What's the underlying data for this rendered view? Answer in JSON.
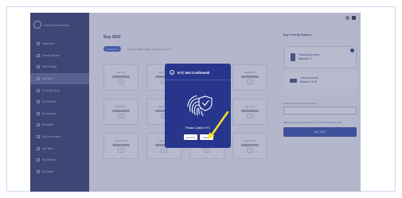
{
  "brand": {
    "name": "SmartCommerce"
  },
  "sidebar": {
    "items": [
      {
        "label": "Dashboard"
      },
      {
        "label": "Create Website"
      },
      {
        "label": "Web Hosting"
      },
      {
        "label": "Buy SMS"
      },
      {
        "label": "Purchase Shop"
      },
      {
        "label": "My Websites"
      },
      {
        "label": "My Accounts"
      },
      {
        "label": "All Wallets"
      },
      {
        "label": "My Shop Orders"
      },
      {
        "label": "My Offers"
      },
      {
        "label": "My Settings"
      },
      {
        "label": "My Mobile"
      }
    ]
  },
  "main": {
    "title": "Buy SMS",
    "tabs": [
      {
        "label": "Global List"
      },
      {
        "label": "Premium SMS (Higher Delivery Success)"
      }
    ],
    "cards": [
      {
        "title": "Air Sms",
        "qty": "1"
      },
      {
        "title": "SMS Bulk",
        "qty": "1"
      },
      {
        "title": "SMS Send",
        "qty": "1"
      },
      {
        "title": "Daily Sms",
        "qty": "1"
      },
      {
        "title": "Vivid Sms",
        "qty": "1"
      },
      {
        "title": "Easy Sms",
        "qty": "1"
      },
      {
        "title": "Bright Sms",
        "qty": "1"
      },
      {
        "title": "Lite Sms",
        "qty": "1"
      },
      {
        "title": "Unlimit Sms",
        "qty": "1"
      },
      {
        "title": "Pro Sms",
        "qty": "1"
      },
      {
        "title": "Smart Sms",
        "qty": "1"
      },
      {
        "title": "Instant Sms",
        "qty": "1"
      }
    ]
  },
  "right": {
    "title": "Buy From My Balance",
    "balance1": {
      "line1": "Trading Accounts",
      "line2": "Balance: $"
    },
    "balance2": {
      "line1": "Cash Accounts",
      "line2": "Balance: $.00"
    },
    "input_label": "Enter Total amount to purchase",
    "note": "Balance that you should add or for",
    "note_link": "SMS Purchase Help",
    "buy_button": "Buy SMS"
  },
  "modal": {
    "title": "KYC Not Confirmed!",
    "message": "Please Confirm KYC",
    "confirm_button": "Go KYC",
    "cancel_button": "Cancel"
  },
  "colors": {
    "sidebar_bg": "#2b3362",
    "modal_bg": "#27368c",
    "accent": "#2c47a8",
    "arrow": "#f5e62a"
  }
}
